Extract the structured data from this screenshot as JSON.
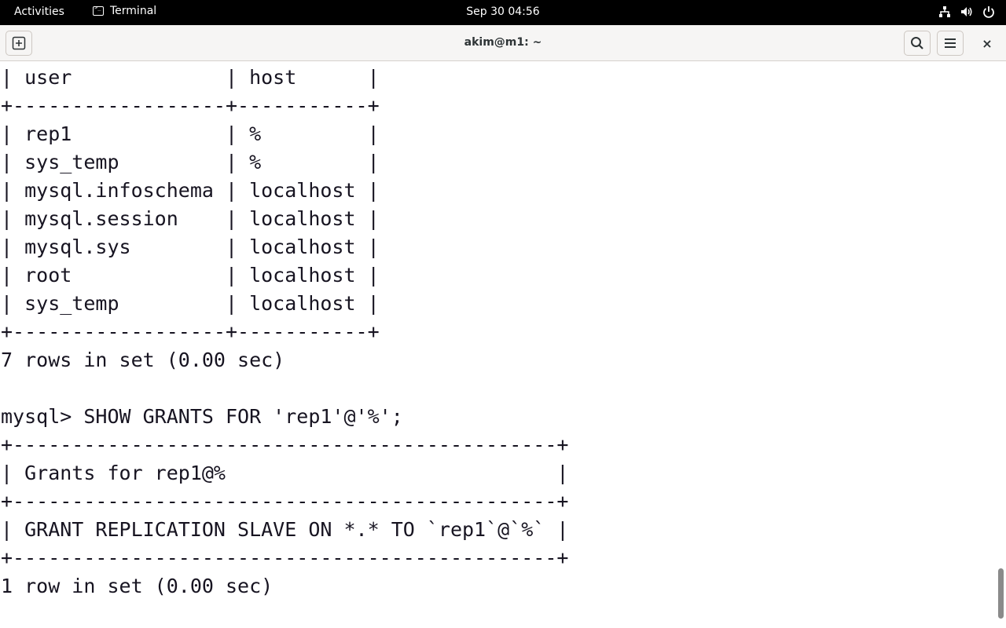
{
  "topbar": {
    "activities": "Activities",
    "app_name": "Terminal",
    "clock": "Sep 30  04:56",
    "tray_icons": [
      "network-icon",
      "volume-icon",
      "power-icon"
    ]
  },
  "window": {
    "title": "akim@m1: ~",
    "close_glyph": "×"
  },
  "terminal": {
    "lines": [
      "| user             | host      |",
      "+------------------+-----------+",
      "| rep1             | %         |",
      "| sys_temp         | %         |",
      "| mysql.infoschema | localhost |",
      "| mysql.session    | localhost |",
      "| mysql.sys        | localhost |",
      "| root             | localhost |",
      "| sys_temp         | localhost |",
      "+------------------+-----------+",
      "7 rows in set (0.00 sec)",
      "",
      "mysql> SHOW GRANTS FOR 'rep1'@'%';",
      "+----------------------------------------------+",
      "| Grants for rep1@%                            |",
      "+----------------------------------------------+",
      "| GRANT REPLICATION SLAVE ON *.* TO `rep1`@`%` |",
      "+----------------------------------------------+",
      "1 row in set (0.00 sec)"
    ]
  },
  "colors": {
    "topbar_bg": "#000000",
    "headerbar_bg": "#f6f5f4",
    "terminal_fg": "#171421",
    "terminal_bg": "#ffffff"
  }
}
